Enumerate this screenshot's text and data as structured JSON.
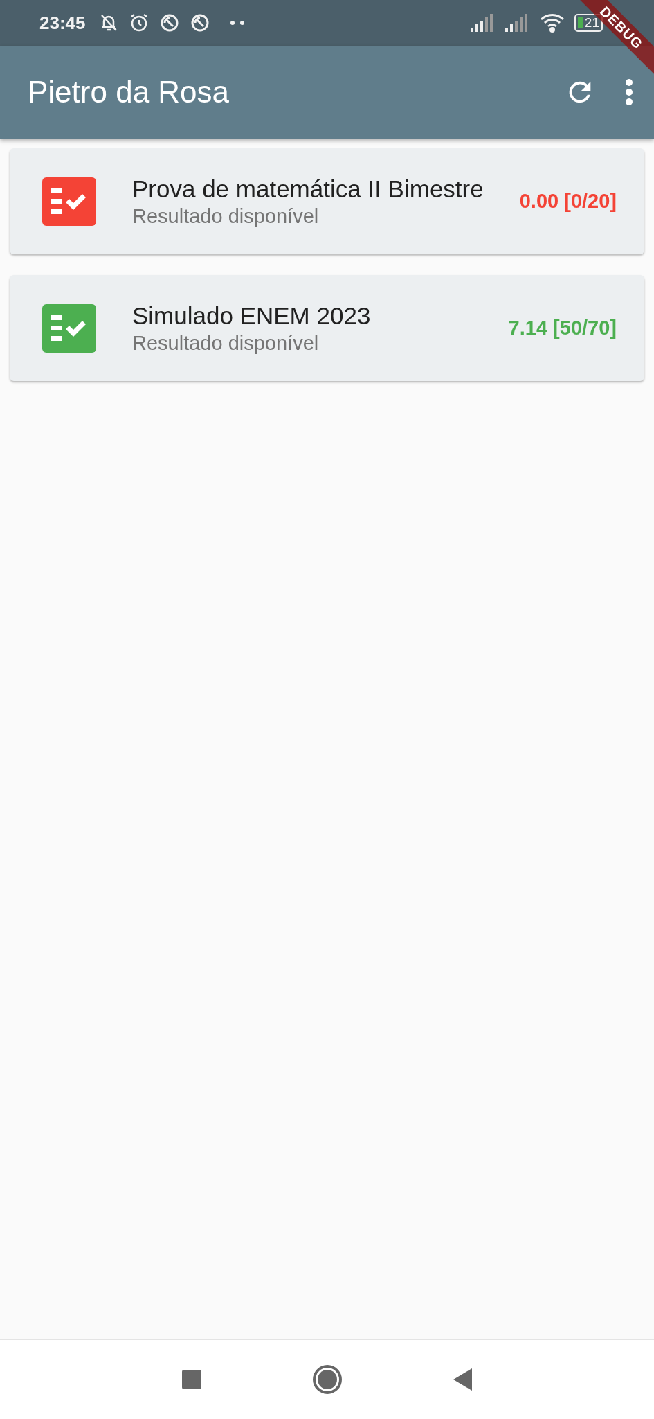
{
  "status_bar": {
    "time": "23:45",
    "battery": "21"
  },
  "app_bar": {
    "title": "Pietro da Rosa"
  },
  "debug_banner": {
    "label": "DEBUG"
  },
  "results": [
    {
      "title": "Prova de matemática II Bimestre",
      "subtitle": "Resultado disponível",
      "score": "0.00 [0/20]",
      "color": "#f44336"
    },
    {
      "title": "Simulado ENEM 2023",
      "subtitle": "Resultado disponível",
      "score": "7.14 [50/70]",
      "color": "#4caf50"
    }
  ]
}
